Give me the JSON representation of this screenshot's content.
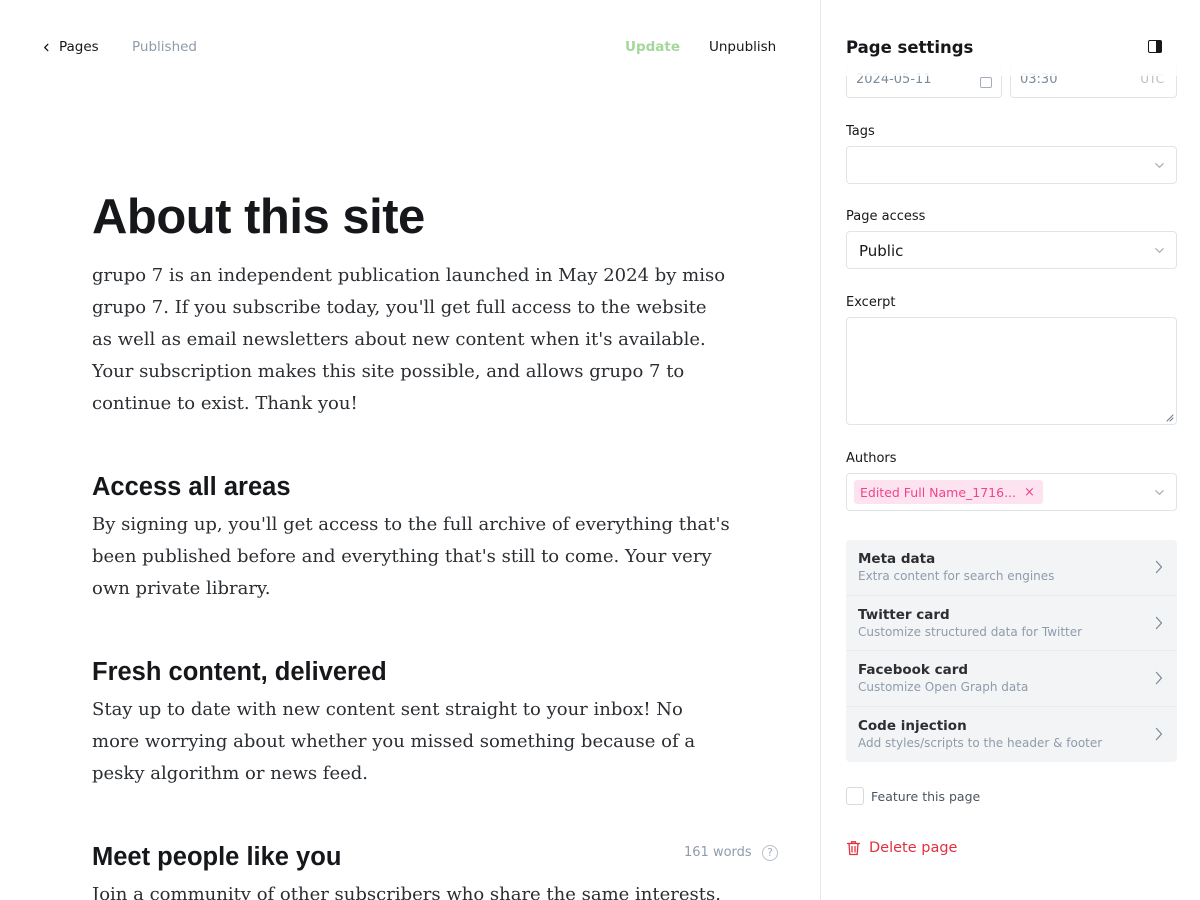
{
  "topbar": {
    "back_label": "Pages",
    "status": "Published",
    "update_label": "Update",
    "unpublish_label": "Unpublish"
  },
  "post": {
    "title": "About this site",
    "intro": "grupo 7 is an independent publication launched in May 2024 by miso grupo 7. If you subscribe today, you'll get full access to the website as well as email newsletters about new content when it's available. Your subscription makes this site possible, and allows grupo 7 to continue to exist. Thank you!",
    "sections": [
      {
        "heading": "Access all areas",
        "body": "By signing up, you'll get access to the full archive of everything that's been published before and everything that's still to come. Your very own private library."
      },
      {
        "heading": "Fresh content, delivered",
        "body": "Stay up to date with new content sent straight to your inbox! No more worrying about whether you missed something because of a pesky algorithm or news feed."
      },
      {
        "heading": "Meet people like you",
        "body": "Join a community of other subscribers who share the same interests."
      }
    ],
    "word_count": "161 words",
    "help_glyph": "?"
  },
  "settings": {
    "title": "Page settings",
    "publish_date": "2024-05-11",
    "publish_time": "03:30",
    "timezone": "UTC",
    "tags_label": "Tags",
    "tags_value": "",
    "access_label": "Page access",
    "access_value": "Public",
    "excerpt_label": "Excerpt",
    "excerpt_value": "",
    "authors_label": "Authors",
    "author_chip": "Edited Full Name_1716...",
    "author_remove": "×",
    "menu": [
      {
        "title": "Meta data",
        "subtitle": "Extra content for search engines"
      },
      {
        "title": "Twitter card",
        "subtitle": "Customize structured data for Twitter"
      },
      {
        "title": "Facebook card",
        "subtitle": "Customize Open Graph data"
      },
      {
        "title": "Code injection",
        "subtitle": "Add styles/scripts to the header & footer"
      }
    ],
    "feature_label": "Feature this page",
    "delete_label": "Delete page"
  },
  "colors": {
    "update": "#a4d89b",
    "author_chip_bg": "#fde3ef",
    "author_chip_text": "#f0448c",
    "delete": "#e1313e"
  },
  "icons": [
    "chevron-left-icon",
    "panel-toggle-icon",
    "calendar-icon",
    "chevron-down-icon",
    "chevron-right-icon",
    "help-icon",
    "trash-icon"
  ]
}
